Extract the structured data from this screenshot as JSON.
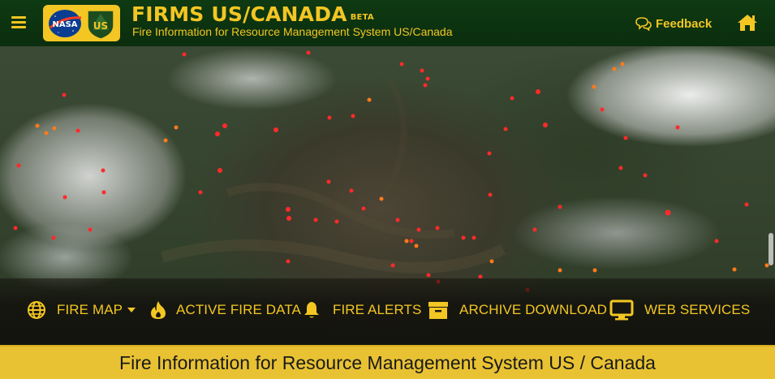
{
  "header": {
    "title": "FIRMS US/CANADA",
    "beta": "BETA",
    "subtitle": "Fire Information for Resource Management System US/Canada",
    "feedback_label": "Feedback",
    "logo_left": "NASA",
    "logo_right": "US"
  },
  "icons": {
    "menu": "hamburger-icon",
    "feedback": "chat-bubble-icon",
    "home": "home-icon",
    "fire_map": "globe-icon",
    "active_fire": "flame-icon",
    "alerts": "bell-icon",
    "archive": "archive-box-icon",
    "web_services": "monitor-icon",
    "dropdown": "caret-down-icon"
  },
  "nav": {
    "fire_map": "FIRE MAP",
    "active_fire_data": "ACTIVE FIRE DATA",
    "fire_alerts": "FIRE ALERTS",
    "archive_download": "ARCHIVE DOWNLOAD",
    "web_services": "WEB SERVICES"
  },
  "banner": {
    "text": "Fire Information for Resource Management System US / Canada"
  },
  "colors": {
    "accent": "#f3c623",
    "header_bg": "#0e3a12",
    "banner_bg": "#e8c233",
    "fire_red": "#ff2a2a",
    "fire_orange": "#ff7a1a"
  }
}
